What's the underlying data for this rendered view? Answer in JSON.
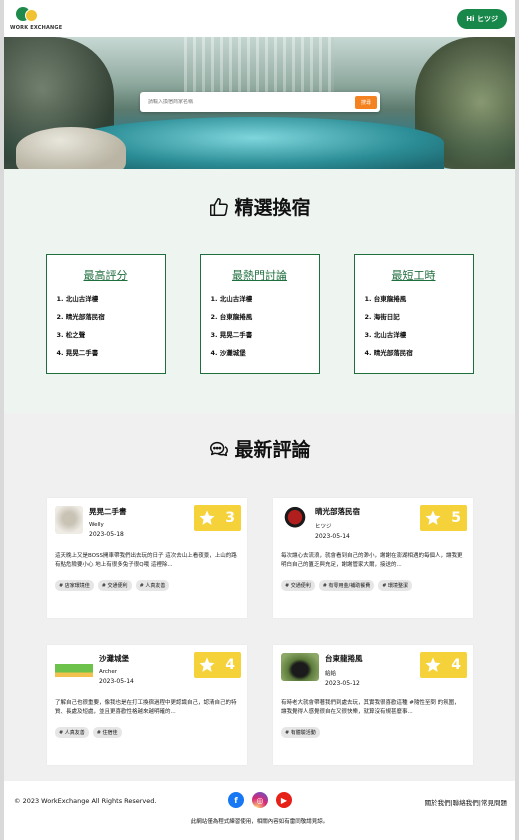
{
  "header": {
    "logo_text": "WORK EXCHANGE",
    "user_button": "Hi ヒツジ"
  },
  "hero": {
    "search_placeholder": "請輸入換宿商家名稱",
    "search_button": "搜尋"
  },
  "featured": {
    "title": "精選換宿",
    "cards": [
      {
        "heading": "最高評分",
        "items": [
          "1. 北山古洋樓",
          "2. 晴光部落民宿",
          "3. 松之聲",
          "4. 晃晃二手書"
        ]
      },
      {
        "heading": "最熱門討論",
        "items": [
          "1. 北山古洋樓",
          "2. 台東龍捲風",
          "3. 晃晃二手書",
          "4. 沙灘城堡"
        ]
      },
      {
        "heading": "最短工時",
        "items": [
          "1. 台東龍捲風",
          "2. 海街日記",
          "3. 北山古洋樓",
          "4. 晴光部落民宿"
        ]
      }
    ]
  },
  "reviews": {
    "title": "最新評論",
    "items": [
      {
        "name": "晃晃二手書",
        "user": "Welly",
        "date": "2023-05-18",
        "rating": "3",
        "text": "這天晚上又是BOSS開車帶我們出去玩的日子 這次去山上看夜景，上山的路有點危險要小心 地上有很多兔子很Q哦 這裡除...",
        "tags": [
          "# 店家環境佳",
          "# 交通便利",
          "# 人真友善"
        ]
      },
      {
        "name": "晴光部落民宿",
        "user": "ヒツジ",
        "date": "2023-05-14",
        "rating": "5",
        "text": "每次讓心去流浪，就會看到自己的渺小，謝謝在澎湖相遇的每個人，讓我更明白自己的匱乏與充足，謝謝管家大爾，接送的...",
        "tags": [
          "# 交通便利",
          "# 有零用金/補助餐費",
          "# 環境整潔"
        ]
      },
      {
        "name": "沙灘城堡",
        "user": "Archer",
        "date": "2023-05-14",
        "rating": "4",
        "text": "了解自己也很重要，像我也是在打工換宿過程中更認識自己，認清自己的特質、長處及短處，並且更喜歡性格越來越明確的...",
        "tags": [
          "# 人真友善",
          "# 住宿佳"
        ]
      },
      {
        "name": "台東龍捲風",
        "user": "給給",
        "date": "2023-05-12",
        "rating": "4",
        "text": "有時老大就會帶著我們到處去玩，其實我很喜歡這種 #隨性至問 的氛圍，讓我覺得人感覺很自在又很快樂，就算沒有規甚麼事...",
        "tags": [
          "# 有體驗活動"
        ]
      }
    ]
  },
  "footer": {
    "copyright": "© 2023 WorkExchange All Rights Reserved.",
    "links": [
      "關於我們",
      "聯絡我們",
      "常見問題"
    ],
    "disclaimer": "此網站僅為程式練習使用，相關內容如有雷同敬請見諒。"
  },
  "colors": {
    "brand_green": "#17874a",
    "accent_orange": "#f58220",
    "rating_yellow": "#f5d23a"
  },
  "icons": {
    "featured": "thumbs-up-icon",
    "reviews": "chat-bubbles-icon",
    "rating": "star-icon",
    "social": [
      "facebook-icon",
      "instagram-icon",
      "youtube-icon"
    ]
  }
}
